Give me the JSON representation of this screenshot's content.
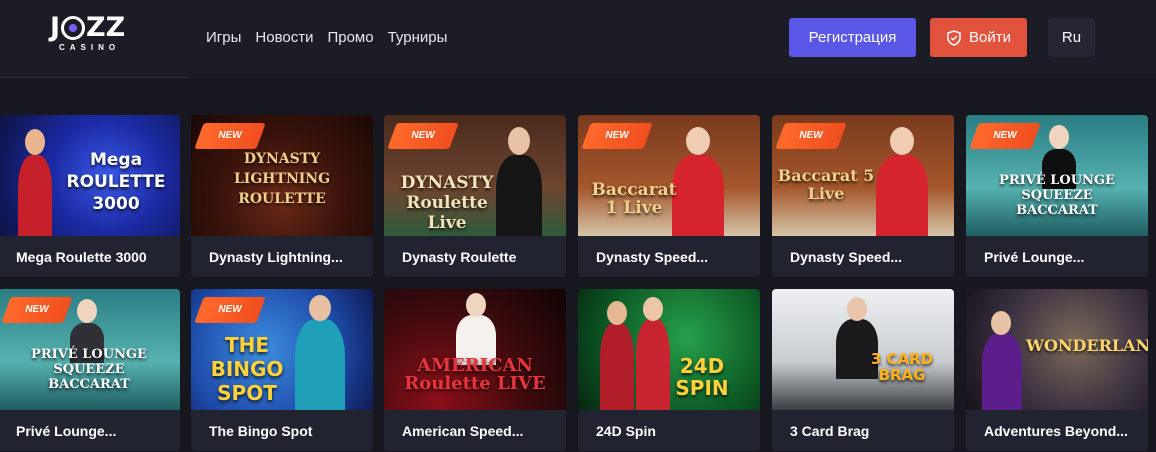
{
  "header": {
    "logo": "JOZZ",
    "logo_sub": "CASINO",
    "nav": [
      "Игры",
      "Новости",
      "Промо",
      "Турниры"
    ],
    "register_label": "Регистрация",
    "login_label": "Войти",
    "lang_label": "Ru"
  },
  "colors": {
    "background": "#16171f",
    "header": "#1b1c26",
    "card": "#222330",
    "register": "#5a57e6",
    "login": "#e2533d",
    "badge": "#f04e1f"
  },
  "games": [
    {
      "label": "Mega Roulette 3000",
      "badge": "",
      "art": "Mega ROULETTE 3000"
    },
    {
      "label": "Dynasty Lightning...",
      "badge": "NEW",
      "art": "DYNASTY LIGHTNING ROULETTE"
    },
    {
      "label": "Dynasty Roulette",
      "badge": "NEW",
      "art": "DYNASTY Roulette Live"
    },
    {
      "label": "Dynasty Speed...",
      "badge": "NEW",
      "art": "Baccarat 1 Live"
    },
    {
      "label": "Dynasty Speed...",
      "badge": "NEW",
      "art": "Baccarat 5 Live"
    },
    {
      "label": "Privé Lounge...",
      "badge": "NEW",
      "art": "PRIVÉ LOUNGE SQUEEZE BACCARAT"
    },
    {
      "label": "Privé Lounge...",
      "badge": "NEW",
      "art": "PRIVÉ LOUNGE SQUEEZE BACCARAT"
    },
    {
      "label": "The Bingo Spot",
      "badge": "NEW",
      "art": "THE BINGO SPOT"
    },
    {
      "label": "American Speed...",
      "badge": "",
      "art": "AMERICAN Roulette LIVE"
    },
    {
      "label": "24D Spin",
      "badge": "",
      "art": "24D SPIN"
    },
    {
      "label": "3 Card Brag",
      "badge": "",
      "art": "3 CARD BRAG"
    },
    {
      "label": "Adventures Beyond...",
      "badge": "",
      "art": "WONDERLAND"
    }
  ]
}
